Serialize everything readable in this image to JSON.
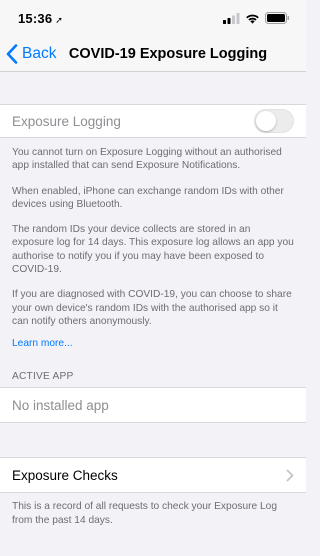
{
  "status": {
    "time": "15:36"
  },
  "nav": {
    "back_label": "Back",
    "title": "COVID-19 Exposure Logging"
  },
  "exposure_logging": {
    "label": "Exposure Logging",
    "toggle_on": false
  },
  "info": {
    "paragraphs": [
      "You cannot turn on Exposure Logging without an authorised app installed that can send Exposure Notifications.",
      "When enabled, iPhone can exchange random IDs with other devices using Bluetooth.",
      "The random IDs your device collects are stored in an exposure log for 14 days. This exposure log allows an app you authorise to notify you if you may have been exposed to COVID-19.",
      "If you are diagnosed with COVID-19, you can choose to share your own device's random IDs with the authorised app so it can notify others anonymously."
    ],
    "learn_more": "Learn more..."
  },
  "active_app": {
    "header": "ACTIVE APP",
    "value": "No installed app"
  },
  "exposure_checks": {
    "label": "Exposure Checks",
    "footer": "This is a record of all requests to check your Exposure Log from the past 14 days."
  },
  "colors": {
    "accent": "#007aff",
    "background": "#f2f2f7",
    "secondary_text": "#6d6d72"
  }
}
